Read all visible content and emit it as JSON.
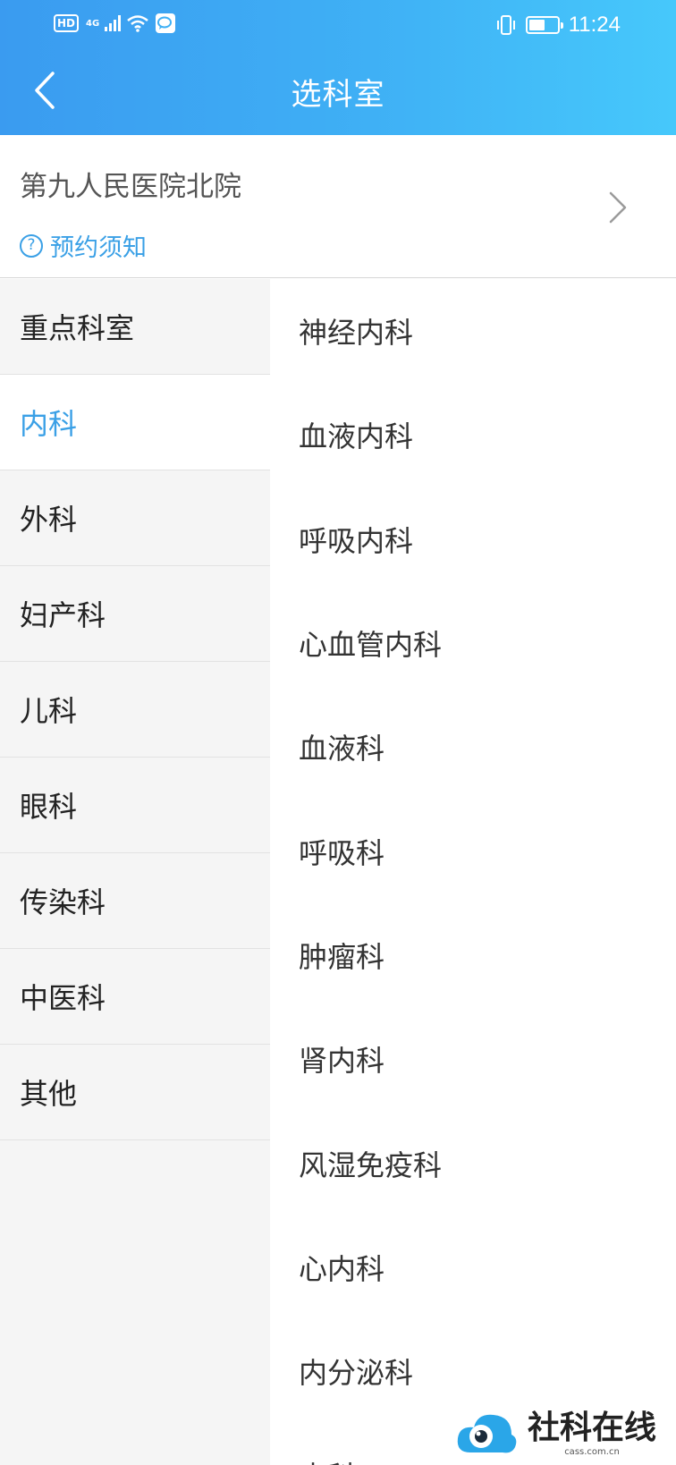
{
  "status_bar": {
    "hd": "HD",
    "network": "4G",
    "time": "11:24",
    "battery_level": 0.55
  },
  "header": {
    "title": "选科室"
  },
  "hospital": {
    "name": "第九人民医院北院",
    "notice_label": "预约须知"
  },
  "categories": [
    {
      "label": "重点科室",
      "active": false
    },
    {
      "label": "内科",
      "active": true
    },
    {
      "label": "外科",
      "active": false
    },
    {
      "label": "妇产科",
      "active": false
    },
    {
      "label": "儿科",
      "active": false
    },
    {
      "label": "眼科",
      "active": false
    },
    {
      "label": "传染科",
      "active": false
    },
    {
      "label": "中医科",
      "active": false
    },
    {
      "label": "其他",
      "active": false
    }
  ],
  "departments": [
    "神经内科",
    "血液内科",
    "呼吸内科",
    "心血管内科",
    "血液科",
    "呼吸科",
    "肿瘤科",
    "肾内科",
    "风湿免疫科",
    "心内科",
    "内分泌科",
    "内科"
  ],
  "watermark": {
    "text": "社科在线",
    "sub": "cass.com.cn"
  },
  "colors": {
    "accent": "#3aa0e6",
    "header_start": "#3a9bf0",
    "header_end": "#46c8fb"
  }
}
